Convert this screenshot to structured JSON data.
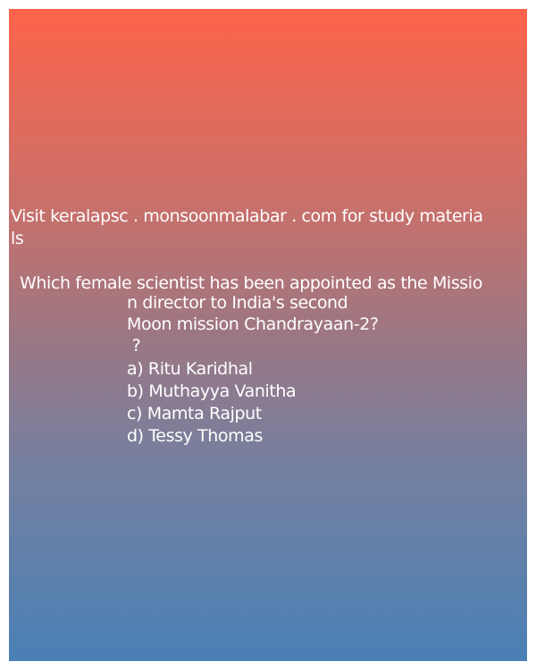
{
  "visit": {
    "line1": "Visit keralapsc . monsoonmalabar . com for study materia",
    "line2": "ls"
  },
  "question": {
    "line1": "Which female scientist has been appointed as the Missio",
    "line2": "n director to India's second",
    "line3": "Moon mission Chandrayaan-2?",
    "line4": " ?"
  },
  "options": [
    "a) Ritu Karidhal",
    "b) Muthayya Vanitha",
    "c) Mamta Rajput",
    "d) Tessy Thomas"
  ]
}
